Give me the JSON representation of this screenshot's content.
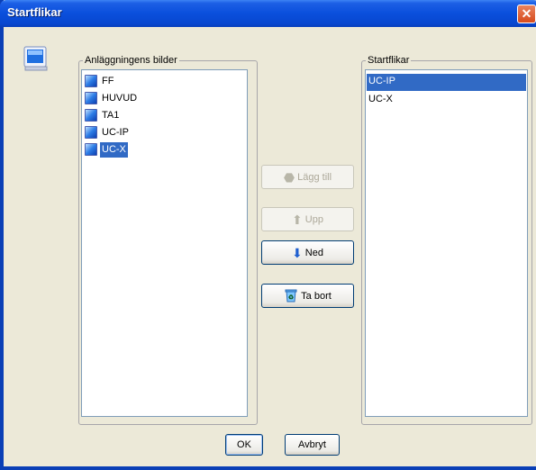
{
  "window": {
    "title": "Startflikar",
    "close_glyph": "✕"
  },
  "left_panel": {
    "label": "Anläggningens bilder",
    "items": [
      {
        "label": "FF",
        "selected": false
      },
      {
        "label": "HUVUD",
        "selected": false
      },
      {
        "label": "TA1",
        "selected": false
      },
      {
        "label": "UC-IP",
        "selected": false
      },
      {
        "label": "UC-X",
        "selected": true
      }
    ]
  },
  "right_panel": {
    "label": "Startflikar",
    "items": [
      {
        "label": "UC-IP",
        "selected": true
      },
      {
        "label": "UC-X",
        "selected": false
      }
    ]
  },
  "buttons": {
    "add": {
      "label": "Lägg till",
      "enabled": false,
      "icon": "add-icon"
    },
    "up": {
      "label": "Upp",
      "enabled": false,
      "icon": "arrow-up-icon"
    },
    "down": {
      "label": "Ned",
      "enabled": true,
      "icon": "arrow-down-icon"
    },
    "remove": {
      "label": "Ta bort",
      "enabled": true,
      "icon": "recycle-bin-icon"
    },
    "ok": {
      "label": "OK"
    },
    "cancel": {
      "label": "Avbryt"
    }
  },
  "colors": {
    "selection": "#316ac5",
    "titlebar": "#0a4fdc",
    "dialog_bg": "#ece9d8"
  }
}
